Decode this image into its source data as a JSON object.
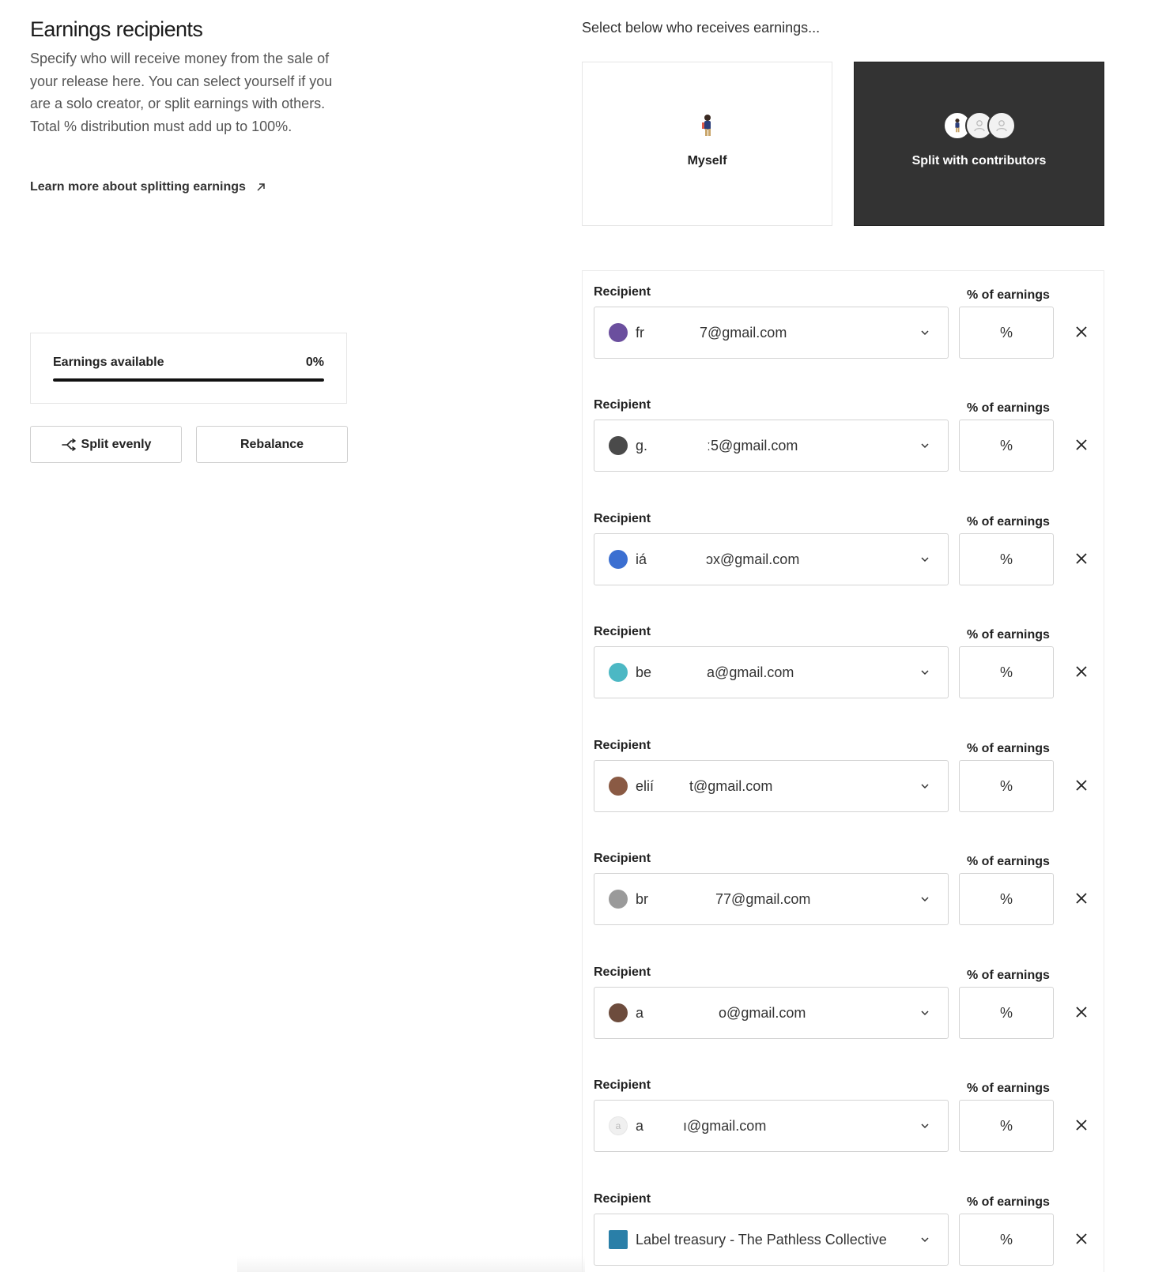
{
  "left": {
    "title": "Earnings recipients",
    "description": "Specify who will receive money from the sale of your release here. You can select yourself if you are a solo creator, or split earnings with others. Total % distribution must add up to 100%.",
    "learn_more": "Learn more about splitting earnings",
    "earnings": {
      "label": "Earnings available",
      "value": "0%",
      "bar_fill_fraction": 1.0
    },
    "buttons": {
      "split_evenly": "Split evenly",
      "rebalance": "Rebalance"
    }
  },
  "right": {
    "heading": "Select below who receives earnings...",
    "choices": {
      "myself": "Myself",
      "split": "Split with contributors",
      "selected": "split"
    },
    "recipient_label": "Recipient",
    "percent_label": "% of earnings",
    "percent_placeholder": "%",
    "recipients": [
      {
        "text": "fr              7@gmail.com",
        "avatar_color": "#6b4f9e"
      },
      {
        "text": "g.               ː5@gmail.com",
        "avatar_color": "#4a4a4a"
      },
      {
        "text": "iá               ɔx@gmail.com",
        "avatar_color": "#3b6fd1"
      },
      {
        "text": "be              a@gmail.com",
        "avatar_color": "#4cb8c4"
      },
      {
        "text": "elií         t@gmail.com",
        "avatar_color": "#8a5a44"
      },
      {
        "text": "br                 77@gmail.com",
        "avatar_color": "#9a9a9a"
      },
      {
        "text": "a                   o@gmail.com",
        "avatar_color": "#6d4c3d"
      },
      {
        "text": "a          ı@gmail.com",
        "avatar_initial": "a",
        "avatar_color": "#f0f0f0"
      },
      {
        "text": "Label treasury - The Pathless Collective",
        "avatar_color": "#2a7fa8"
      }
    ]
  },
  "colors": {
    "selected_card": "#333333",
    "border": "#d3d3d3"
  }
}
